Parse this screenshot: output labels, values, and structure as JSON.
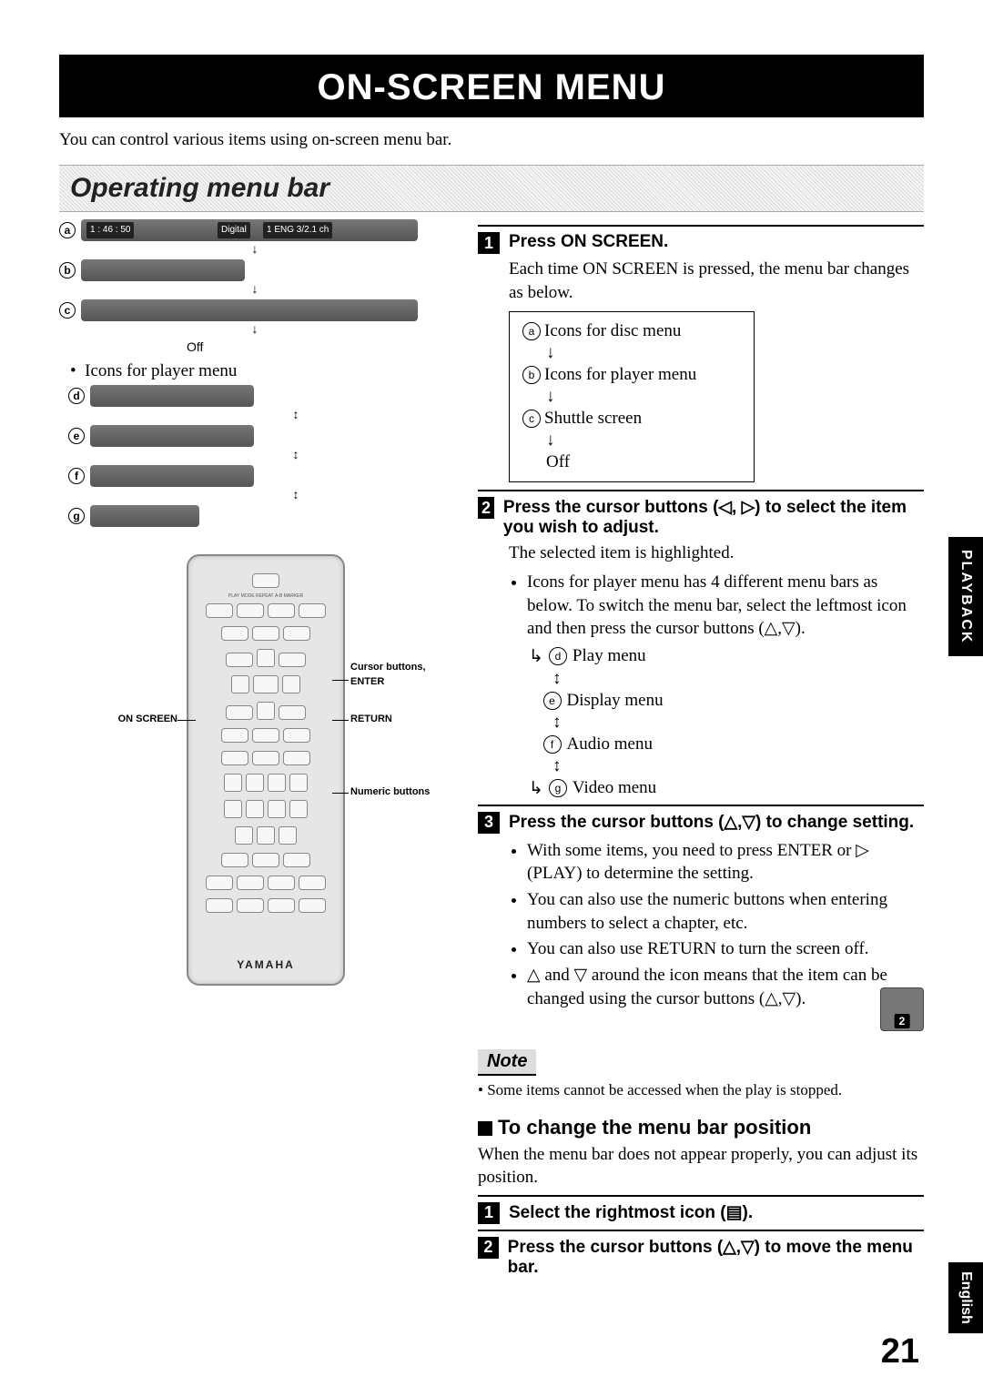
{
  "title": "ON-SCREEN MENU",
  "intro": "You can control various items using on-screen menu bar.",
  "section": "Operating menu bar",
  "left": {
    "labels": {
      "a": "a",
      "b": "b",
      "c": "c",
      "d": "d",
      "e": "e",
      "f": "f",
      "g": "g"
    },
    "barA_time": "1 : 46 : 50",
    "barA_aud": "1 ENG 3/2.1 ch",
    "barA_digital": "Digital",
    "off": "Off",
    "playerIconsH": "Icons for player menu",
    "remote": {
      "onScreen": "ON SCREEN",
      "cursor": "Cursor buttons,",
      "enter": "ENTER",
      "return": "RETURN",
      "numeric": "Numeric buttons",
      "brand": "YAMAHA"
    }
  },
  "right": {
    "s1": {
      "h": "Press ON SCREEN.",
      "p": "Each time ON SCREEN is pressed, the menu bar changes as below.",
      "a": "Icons for disc menu",
      "b": "Icons for player menu",
      "c": "Shuttle screen",
      "off": "Off"
    },
    "s2": {
      "h": "Press the cursor buttons (◁, ▷) to select the item you wish to adjust.",
      "p": "The selected item is highlighted.",
      "b1": "Icons for player menu has 4 different menu bars as below. To switch the menu bar, select the leftmost icon and then press the cursor buttons (△,▽).",
      "d": "Play menu",
      "e": "Display menu",
      "f": "Audio menu",
      "g": "Video menu"
    },
    "s3": {
      "h": "Press the cursor buttons (△,▽) to change setting.",
      "b1": "With some items, you need to press ENTER or ▷ (PLAY) to determine the setting.",
      "b2": "You can also use the numeric buttons when entering numbers to select a chapter, etc.",
      "b3": "You can also use RETURN to turn the screen off.",
      "b4": "△ and ▽ around the icon means that the item can be changed using the cursor buttons (△,▽)."
    },
    "note_h": "Note",
    "note_t": "• Some items cannot be accessed when the play is stopped.",
    "changeH": "To change the menu bar position",
    "changeP": "When the menu bar does not appear properly, you can adjust its position.",
    "ch1": "Select the rightmost icon (▤).",
    "ch2": "Press the cursor buttons (△,▽) to move the menu bar."
  },
  "tabs": {
    "playback": "PLAYBACK",
    "english": "English"
  },
  "pageNum": "21"
}
